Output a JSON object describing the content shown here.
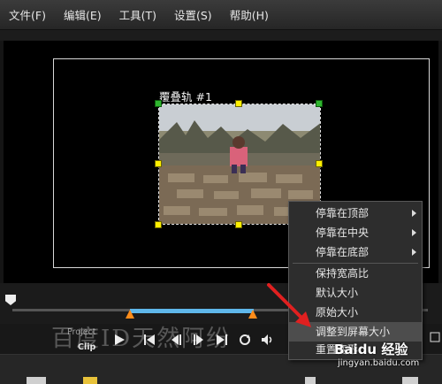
{
  "menu": {
    "file": "文件(F)",
    "edit": "编辑(E)",
    "tools": "工具(T)",
    "settings": "设置(S)",
    "help": "帮助(H)"
  },
  "preview": {
    "overlay_title": "覆叠轨 #1"
  },
  "transport": {
    "mode_project": "Project",
    "mode_clip": "Clip"
  },
  "context_menu": {
    "items": [
      {
        "label": "停靠在顶部",
        "submenu": true
      },
      {
        "label": "停靠在中央",
        "submenu": true
      },
      {
        "label": "停靠在底部",
        "submenu": true
      },
      {
        "label": "保持宽高比",
        "submenu": false
      },
      {
        "label": "默认大小",
        "submenu": false
      },
      {
        "label": "原始大小",
        "submenu": false
      },
      {
        "label": "调整到屏幕大小",
        "submenu": false,
        "highlighted": true
      },
      {
        "label": "重置变形",
        "submenu": false
      }
    ]
  },
  "watermark": {
    "text": "百度ID天然阿纷",
    "logo": "Baidu 经验",
    "url": "jingyan.baidu.com"
  },
  "colors": {
    "handle_yellow": "#ffef00",
    "trim_blue": "#5fb7ea",
    "trim_orange": "#ff8c1a",
    "arrow_red": "#e02020"
  }
}
